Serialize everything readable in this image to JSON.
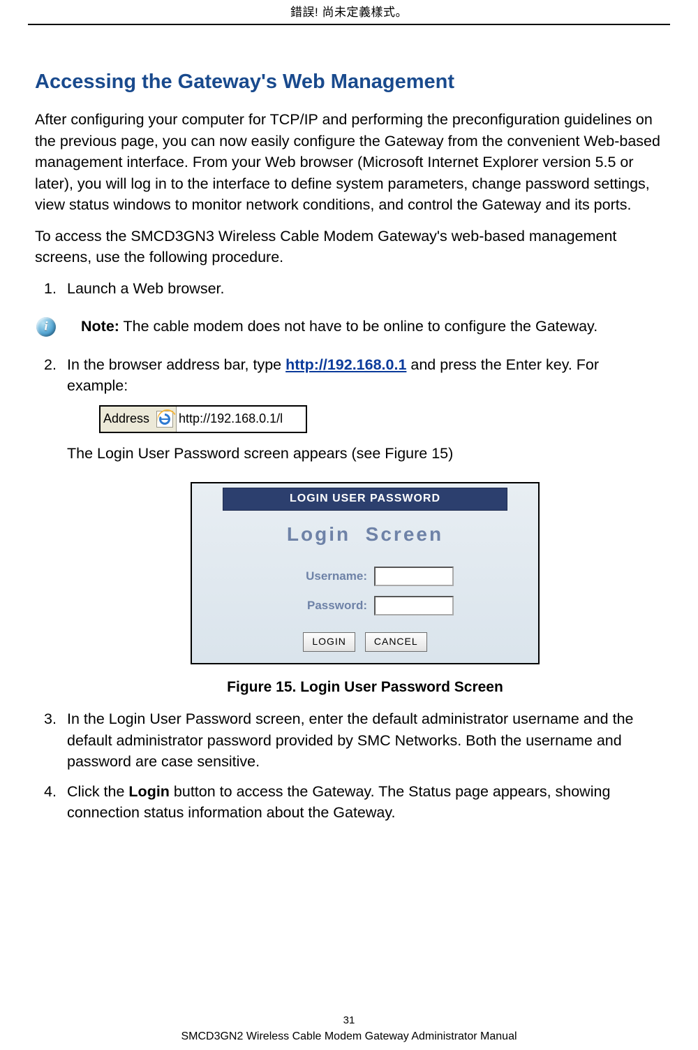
{
  "header": {
    "title": "錯誤! 尚未定義樣式。"
  },
  "section": {
    "heading": "Accessing the Gateway's Web Management"
  },
  "paragraphs": {
    "p1": "After configuring your computer for TCP/IP and performing the preconfiguration guidelines on the previous page, you can now easily configure the Gateway from the convenient Web-based management interface. From your Web browser (Microsoft Internet Explorer version 5.5 or later), you will log in to the interface to define system parameters, change password settings, view status windows to monitor network conditions, and control the Gateway and its ports.",
    "p2": "To access the SMCD3GN3 Wireless Cable Modem Gateway's web-based management screens, use the following procedure."
  },
  "steps": {
    "s1": "Launch a Web browser.",
    "s2_prefix": "In the browser address bar, type ",
    "s2_link": "http://192.168.0.1",
    "s2_suffix": " and press the Enter key. For example:",
    "s2_after": "The Login User Password screen appears (see Figure 15)",
    "s3": "In the Login User Password screen, enter the default administrator username and the default administrator password provided by SMC Networks. Both the username and password are case sensitive.",
    "s4_prefix": "Click the ",
    "s4_bold": "Login",
    "s4_suffix": " button to access the Gateway. The Status page appears, showing connection status information about the Gateway."
  },
  "note": {
    "label": "Note:",
    "text": " The cable modem does not have to be online to configure the Gateway."
  },
  "addressbar": {
    "label": "Address",
    "value": "http://192.168.0.1/l"
  },
  "login": {
    "title": "LOGIN USER PASSWORD",
    "heading_a": "Login",
    "heading_b": "Screen",
    "username_label": "Username:",
    "password_label": "Password:",
    "login_btn": "LOGIN",
    "cancel_btn": "CANCEL"
  },
  "figure": {
    "caption": "Figure 15. Login User Password Screen"
  },
  "footer": {
    "page": "31",
    "manual": "SMCD3GN2 Wireless Cable Modem Gateway Administrator Manual"
  }
}
